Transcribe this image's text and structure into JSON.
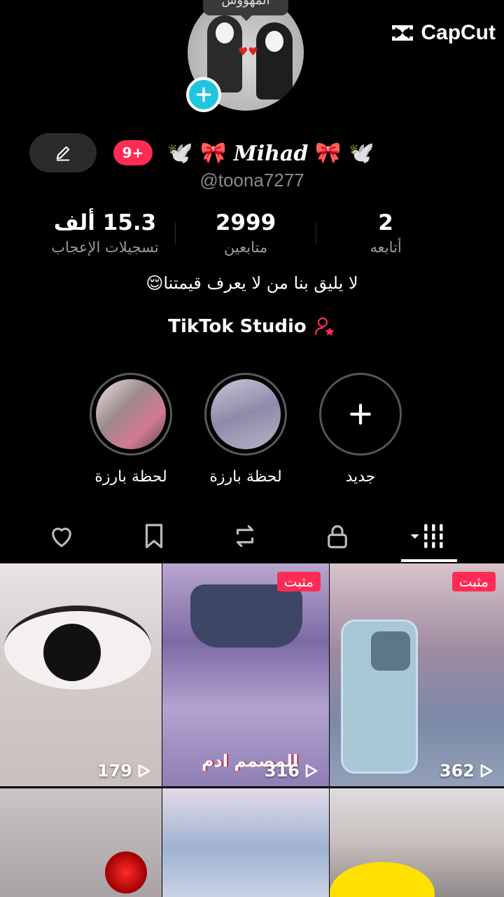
{
  "top": {
    "avatar_tooltip": "المهووس",
    "watermark": "CapCut"
  },
  "profile": {
    "notifications_badge": "9+",
    "display_name": "Mihad",
    "handle": "@toona7277",
    "bio": "لا يليق بنا من لا يعرف قيمتنا😌",
    "studio_label": "TikTok Studio"
  },
  "stats": {
    "likes": {
      "value": "15.3 ألف",
      "label": "تسجيلات الإعجاب"
    },
    "followers": {
      "value": "2999",
      "label": "متابعين"
    },
    "following": {
      "value": "2",
      "label": "أتابعه"
    }
  },
  "highlights": [
    {
      "label": "لحظة بارزة"
    },
    {
      "label": "لحظة بارزة"
    },
    {
      "label": "جديد"
    }
  ],
  "tabs": [
    {
      "icon": "grid-icon",
      "active": true
    },
    {
      "icon": "lock-icon"
    },
    {
      "icon": "repost-icon"
    },
    {
      "icon": "bookmark-icon"
    },
    {
      "icon": "heart-icon"
    }
  ],
  "videos": [
    {
      "views": "179",
      "pinned": false
    },
    {
      "views": "316",
      "pinned": true,
      "pinned_label": "مثبت",
      "watermark": "المصمم ادم"
    },
    {
      "views": "362",
      "pinned": true,
      "pinned_label": "مثبت"
    },
    {
      "views": null
    },
    {
      "views": null
    },
    {
      "views": null
    }
  ],
  "colors": {
    "accent": "#fe2c55",
    "add_button": "#20c5e0",
    "background": "#000000"
  }
}
